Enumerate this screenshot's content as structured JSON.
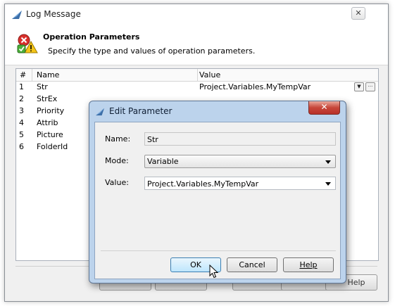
{
  "window": {
    "title": "Log Message",
    "close_label": "✕"
  },
  "header": {
    "title": "Operation Parameters",
    "subtitle": "Specify the type and values of operation parameters."
  },
  "grid": {
    "columns": [
      "#",
      "Name",
      "Value"
    ],
    "rows": [
      {
        "num": "1",
        "name": "Str",
        "value": "Project.Variables.MyTempVar"
      },
      {
        "num": "2",
        "name": "StrEx",
        "value": ""
      },
      {
        "num": "3",
        "name": "Priority",
        "value": ""
      },
      {
        "num": "4",
        "name": "Attrib",
        "value": ""
      },
      {
        "num": "5",
        "name": "Picture",
        "value": ""
      },
      {
        "num": "6",
        "name": "FolderId",
        "value": ""
      }
    ],
    "dropdown_glyph": "▼",
    "ellipsis_glyph": "···"
  },
  "outer_buttons": {
    "help_label": "Help"
  },
  "dialog": {
    "title": "Edit Parameter",
    "close_label": "✕",
    "name_label": "Name:",
    "name_value": "Str",
    "mode_label": "Mode:",
    "mode_value": "Variable",
    "value_label": "Value:",
    "value_value": "Project.Variables.MyTempVar",
    "ok_label": "OK",
    "cancel_label": "Cancel",
    "help_label": "Help"
  },
  "colors": {
    "dialog_frame": "#bcd3ec",
    "close_red": "#c7463a",
    "default_button": "#bee6fd"
  }
}
